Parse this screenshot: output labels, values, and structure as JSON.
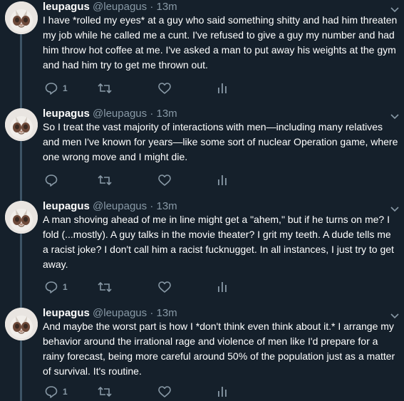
{
  "colors": {
    "background": "#15202b",
    "text": "#ffffff",
    "secondary": "#8899a6",
    "thread_line": "#3d5466"
  },
  "tweets": [
    {
      "name": "leupagus",
      "handle": "@leupagus",
      "separator": "·",
      "time": "13m",
      "text": "I have *rolled my eyes* at a guy who said something shitty and had him threaten my job while he called me a cunt. I've refused to give a guy my number and had him throw hot coffee at me. I've asked a man to put away his weights at the gym and had him try to get me thrown out.",
      "reply_count": "1",
      "icons": {
        "reply": "reply-icon",
        "retweet": "retweet-icon",
        "like": "heart-icon",
        "analytics": "analytics-icon"
      }
    },
    {
      "name": "leupagus",
      "handle": "@leupagus",
      "separator": "·",
      "time": "13m",
      "text": "So I treat the vast majority of interactions with men—including many relatives and men I've known for years—like some sort of nuclear Operation game, where one wrong move and I might die.",
      "reply_count": "",
      "icons": {
        "reply": "reply-icon",
        "retweet": "retweet-icon",
        "like": "heart-icon",
        "analytics": "analytics-icon"
      }
    },
    {
      "name": "leupagus",
      "handle": "@leupagus",
      "separator": "·",
      "time": "13m",
      "text": "A man shoving ahead of me in line might get a \"ahem,\" but if he turns on me? I fold (...mostly). A guy talks in the movie theater? I grit my teeth. A dude tells me a racist joke? I don't call him a racist fucknugget. In all instances, I just try to get away.",
      "reply_count": "1",
      "icons": {
        "reply": "reply-icon",
        "retweet": "retweet-icon",
        "like": "heart-icon",
        "analytics": "analytics-icon"
      }
    },
    {
      "name": "leupagus",
      "handle": "@leupagus",
      "separator": "·",
      "time": "13m",
      "text": "And maybe the worst part is how I *don't think even think about it.* I arrange my behavior around the irrational rage and violence of men like I'd prepare for a rainy forecast, being more careful around 50% of the population just as a matter of survival. It's routine.",
      "reply_count": "1",
      "icons": {
        "reply": "reply-icon",
        "retweet": "retweet-icon",
        "like": "heart-icon",
        "analytics": "analytics-icon"
      }
    }
  ]
}
